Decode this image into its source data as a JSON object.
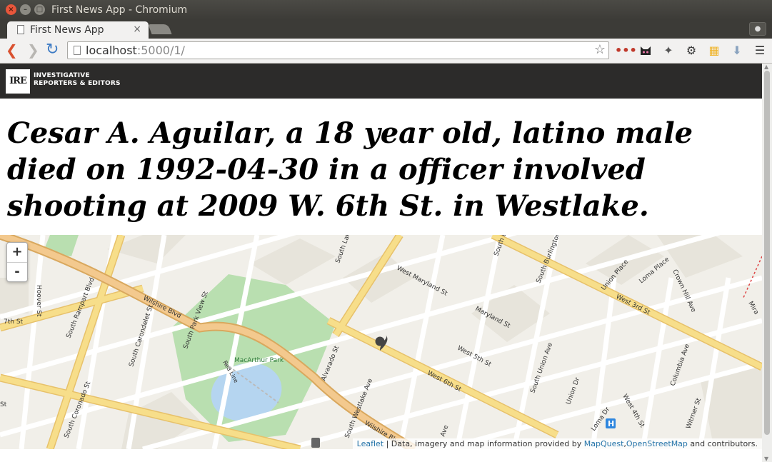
{
  "window": {
    "title": "First News App - Chromium"
  },
  "tabs": [
    {
      "label": "First News App"
    }
  ],
  "toolbar": {
    "url_host": "localhost",
    "url_rest": ":5000/1/"
  },
  "site": {
    "logo_text": "IRE",
    "org_name_line1": "INVESTIGATIVE",
    "org_name_line2": "REPORTERS & EDITORS"
  },
  "article": {
    "headline": "Cesar A. Aguilar, a 18 year old, latino male died on 1992-04-30 in a officer involved shooting at 2009 W. 6th St. in Westlake."
  },
  "map": {
    "zoom_in": "+",
    "zoom_out": "-",
    "labels": {
      "park": "MacArthur Park",
      "wilshire": "Wilshire Blvd",
      "wilshire2": "Wilshire Blvd",
      "west6th": "West 6th St",
      "west5th": "West 5th St",
      "west3rd": "West 3rd St",
      "alvarado": "Alvarado St",
      "hoover": "Hoover St",
      "rampart": "South Rampart Blvd",
      "carondelet": "South Carondelet St",
      "parkview": "South Park View St",
      "coronado": "South Coronado St",
      "westlake": "South Westlake Ave",
      "southlake": "South Lake",
      "maryland": "West Maryland St",
      "maryland2": "Maryland St",
      "burlington": "South Burlington Ave",
      "union": "South Union Ave",
      "uniondr": "Union Dr",
      "unionpl": "Union Place",
      "loma": "Loma Place",
      "lomadr": "Loma Dr",
      "crownhill": "Crown Hill Ave",
      "columbia": "Columbia Ave",
      "west4th": "West 4th St",
      "witmer": "Witmer St",
      "redline": "Red Line",
      "w7th": "7th St",
      "southbo": "South Bo",
      "mira": "Mira",
      "ave": "Ave",
      "st": "St"
    },
    "attribution": {
      "leaflet": "Leaflet",
      "sep": " | Data, imagery and map information provided by ",
      "mapquest": "MapQuest",
      "comma": ",",
      "osm": "OpenStreetMap",
      "tail": " and contributors."
    },
    "colors": {
      "land": "#f1efe9",
      "major_road": "#f7de8a",
      "major_road_edge": "#e7c16a",
      "wilshire": "#f3c98e",
      "minor_road": "#ffffff",
      "park": "#b9dfb0",
      "water": "#b5d5f0",
      "block": "#e7e4db",
      "marker": "#444444"
    }
  }
}
